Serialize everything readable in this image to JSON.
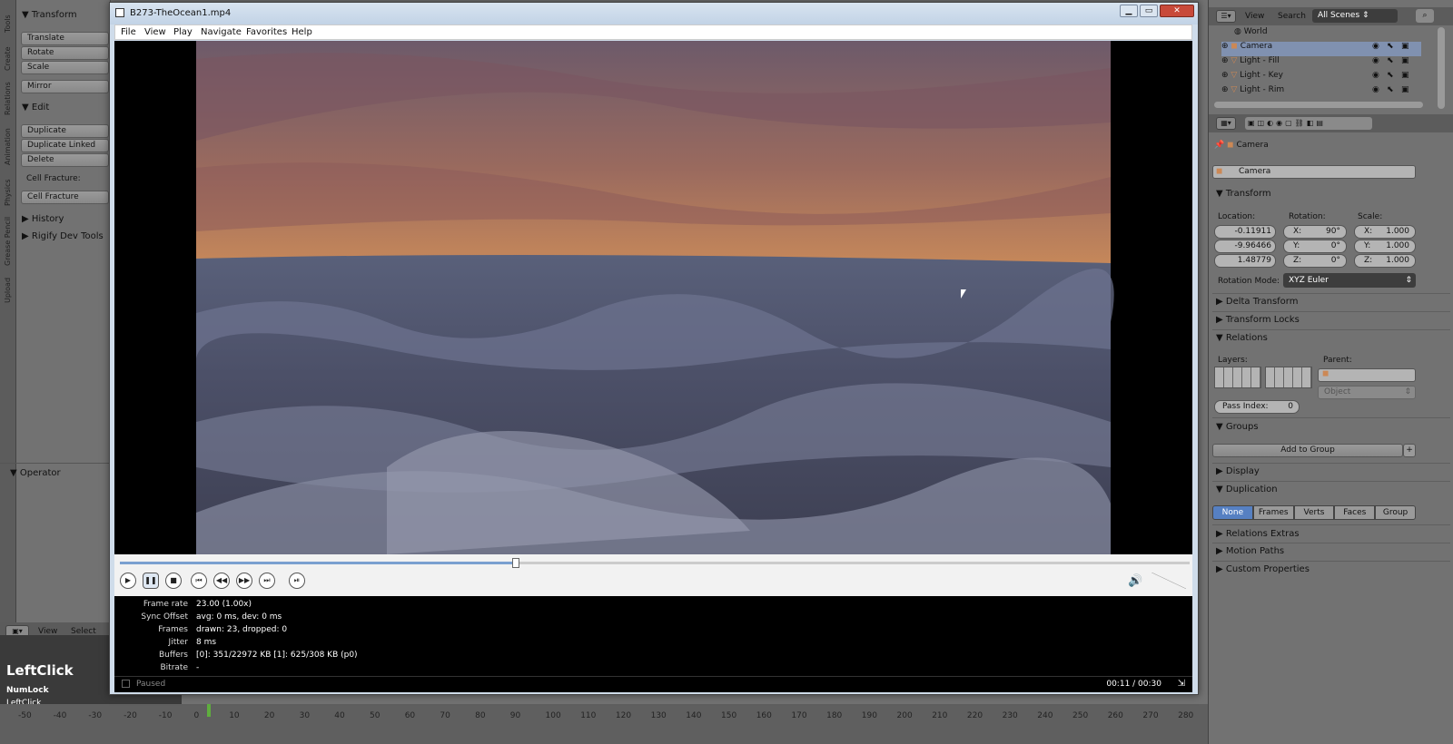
{
  "blender_left": {
    "vertical_tabs": [
      "Tools",
      "Create",
      "Relations",
      "Animation",
      "Physics",
      "Grease Pencil",
      "Upload"
    ],
    "transform_header": "Transform",
    "transform_buttons": [
      "Translate",
      "Rotate",
      "Scale"
    ],
    "mirror": "Mirror",
    "edit_header": "Edit",
    "edit_buttons": [
      "Duplicate",
      "Duplicate Linked",
      "Delete"
    ],
    "cell_fracture_label": "Cell Fracture:",
    "cell_fracture_button": "Cell Fracture",
    "history": "History",
    "rigify": "Rigify Dev Tools",
    "operator": "Operator",
    "view": "View",
    "select": "Select"
  },
  "keys": {
    "main": "LeftClick",
    "line1": "NumLock",
    "line2": "LeftClick"
  },
  "timeline": {
    "ticks": [
      "-50",
      "-40",
      "-30",
      "-20",
      "-10",
      "0",
      "10",
      "20",
      "30",
      "40",
      "50",
      "60",
      "70",
      "80",
      "90",
      "100",
      "110",
      "120",
      "130",
      "140",
      "150",
      "160",
      "170",
      "180",
      "190",
      "200",
      "210",
      "220",
      "230",
      "240",
      "250",
      "260",
      "270",
      "280"
    ]
  },
  "player": {
    "title": "B273-TheOcean1.mp4",
    "menu": [
      "File",
      "View",
      "Play",
      "Navigate",
      "Favorites",
      "Help"
    ],
    "stats": [
      {
        "k": "Frame rate",
        "v": "23.00 (1.00x)"
      },
      {
        "k": "Sync Offset",
        "v": "avg: 0 ms, dev: 0 ms"
      },
      {
        "k": "Frames",
        "v": "drawn: 23, dropped: 0"
      },
      {
        "k": "Jitter",
        "v": "8 ms"
      },
      {
        "k": "Buffers",
        "v": "[0]: 351/22972 KB [1]: 625/308 KB (p0)"
      },
      {
        "k": "Bitrate",
        "v": "-"
      }
    ],
    "status": "Paused",
    "time": "00:11 / 00:30",
    "progress": 0.37
  },
  "outliner": {
    "view": "View",
    "search": "Search",
    "scenes": "All Scenes",
    "items": [
      "World",
      "Camera",
      "Light - Fill",
      "Light - Key",
      "Light - Rim"
    ]
  },
  "properties": {
    "object_crumb": "Camera",
    "object_name": "Camera",
    "transform": "Transform",
    "location_label": "Location:",
    "rotation_label": "Rotation:",
    "scale_label": "Scale:",
    "location": [
      "-0.11911",
      "-9.96466",
      "1.48779"
    ],
    "rotation": [
      {
        "axis": "X:",
        "v": "90°"
      },
      {
        "axis": "Y:",
        "v": "0°"
      },
      {
        "axis": "Z:",
        "v": "0°"
      }
    ],
    "scale": [
      {
        "axis": "X:",
        "v": "1.000"
      },
      {
        "axis": "Y:",
        "v": "1.000"
      },
      {
        "axis": "Z:",
        "v": "1.000"
      }
    ],
    "rotation_mode_label": "Rotation Mode:",
    "rotation_mode": "XYZ Euler",
    "delta": "Delta Transform",
    "locks": "Transform Locks",
    "relations": "Relations",
    "layers": "Layers:",
    "parent": "Parent:",
    "parent_type": "Object",
    "pass_index_label": "Pass Index:",
    "pass_index": "0",
    "groups": "Groups",
    "add_group": "Add to Group",
    "display": "Display",
    "duplication": "Duplication",
    "dup_options": [
      "None",
      "Frames",
      "Verts",
      "Faces",
      "Group"
    ],
    "relations_extras": "Relations Extras",
    "motion_paths": "Motion Paths",
    "custom_props": "Custom Properties"
  },
  "colors": {
    "accent": "#5680c2",
    "player_frame": "#cfdcea"
  }
}
